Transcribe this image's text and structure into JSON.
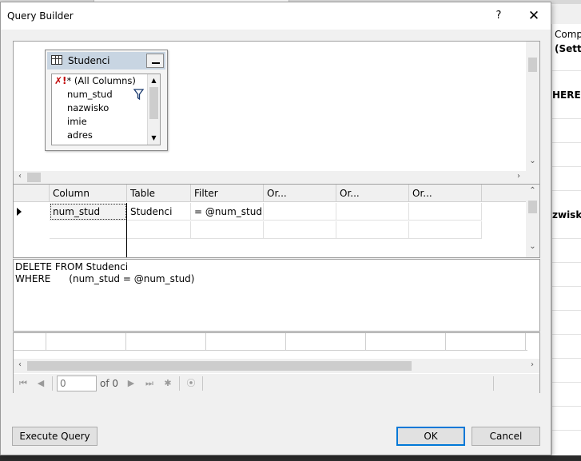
{
  "dialog": {
    "title": "Query Builder",
    "help_label": "?",
    "close_label": "✕"
  },
  "background": {
    "lines": [
      "Comp",
      "(Setti",
      "HERE",
      "zwisko,"
    ]
  },
  "diagram": {
    "table_name": "Studenci",
    "minimize_label": "_",
    "all_columns_icon": "✗!",
    "all_columns_label": "* (All Columns)",
    "columns": [
      "num_stud",
      "nazwisko",
      "imie",
      "adres"
    ],
    "filter_icon": "filter-icon"
  },
  "grid": {
    "headers": [
      "Column",
      "Table",
      "Filter",
      "Or...",
      "Or...",
      "Or..."
    ],
    "rows": [
      {
        "column": "num_stud",
        "table": "Studenci",
        "filter": "= @num_stud",
        "or1": "",
        "or2": "",
        "or3": ""
      }
    ]
  },
  "sql": {
    "line1": "DELETE FROM Studenci",
    "line2": "WHERE      (num_stud = @num_stud)"
  },
  "results": {
    "page_value": "0",
    "page_of": "of 0"
  },
  "buttons": {
    "execute_query": "Execute Query",
    "ok": "OK",
    "cancel": "Cancel"
  }
}
